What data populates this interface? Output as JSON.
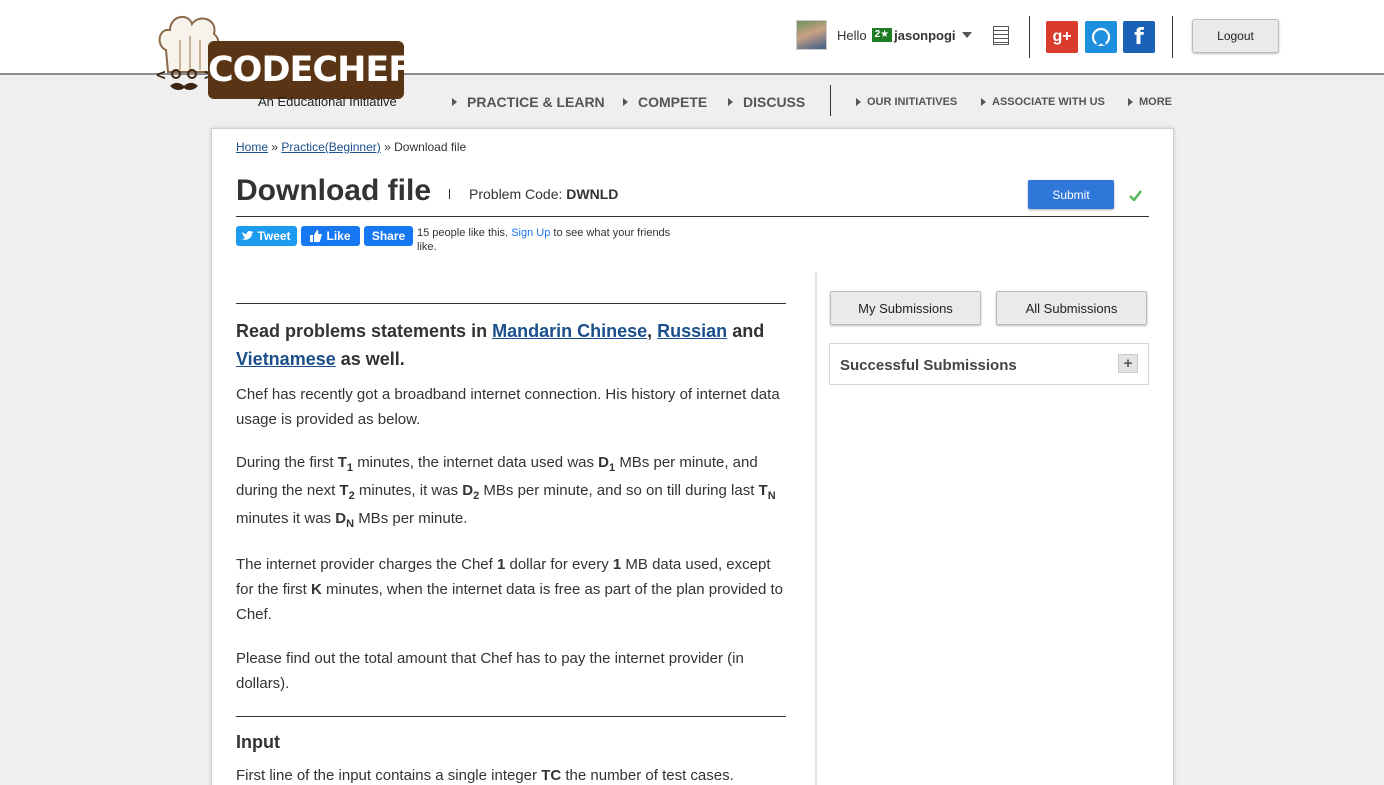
{
  "header": {
    "logo_text": "CODECHEF",
    "logo_tagline": "An Educational Initiative",
    "greeting": "Hello",
    "user_rating": "2★",
    "username": "jasonpogi",
    "logout_label": "Logout",
    "social": {
      "gplus": "g+",
      "facebook": "f"
    }
  },
  "nav": {
    "main": [
      "PRACTICE & LEARN",
      "COMPETE",
      "DISCUSS"
    ],
    "secondary": [
      "OUR INITIATIVES",
      "ASSOCIATE WITH US",
      "MORE"
    ]
  },
  "breadcrumb": {
    "home": "Home",
    "sep1": "»",
    "practice": "Practice(Beginner)",
    "sep2": "»",
    "current": "Download file"
  },
  "problem": {
    "title": "Download file",
    "code_label": "Problem Code:",
    "code": "DWNLD",
    "submit_label": "Submit"
  },
  "share": {
    "tweet_label": "Tweet",
    "like_label": "Like",
    "share_label": "Share",
    "fb_count_text": "15 people like this.",
    "signup_link": "Sign Up",
    "fb_suffix": "to see what your friends like."
  },
  "statement": {
    "lang_prefix": "Read problems statements in",
    "lang_mandarin": "Mandarin Chinese",
    "lang_comma": ",",
    "lang_russian": "Russian",
    "lang_and": "and",
    "lang_vietnamese": "Vietnamese",
    "lang_suffix": "as well.",
    "p1": "Chef has recently got a broadband internet connection. His history of internet data usage is provided as below.",
    "p2": {
      "t1": "During the first",
      "T": "T",
      "s1": "1",
      "t2": "minutes, the internet data used was",
      "D": "D",
      "t3": "MBs per minute, and during the next",
      "s2": "2",
      "t4": "minutes, it was",
      "t5": "MBs per minute, and so on till during last",
      "sN": "N",
      "t6": "minutes it was",
      "t7": "MBs per minute."
    },
    "p3": {
      "t1": "The internet provider charges the Chef",
      "one": "1",
      "t2": "dollar for every",
      "t3": "MB data used, except for the first",
      "K": "K",
      "t4": "minutes, when the internet data is free as part of the plan provided to Chef."
    },
    "p4": "Please find out the total amount that Chef has to pay the internet provider (in dollars).",
    "input_heading": "Input",
    "input": {
      "t1": "First line of the input contains a single integer",
      "TC": "TC",
      "t2": "the number of test cases."
    }
  },
  "sidebar": {
    "my_submissions": "My Submissions",
    "all_submissions": "All Submissions",
    "successful_submissions": "Successful Submissions",
    "expand_symbol": "+"
  },
  "colors": {
    "accent_blue": "#2f78d9",
    "link_blue": "#1b4f8c",
    "brand_brown": "#5a3515",
    "rating_green": "#1e7d22"
  }
}
